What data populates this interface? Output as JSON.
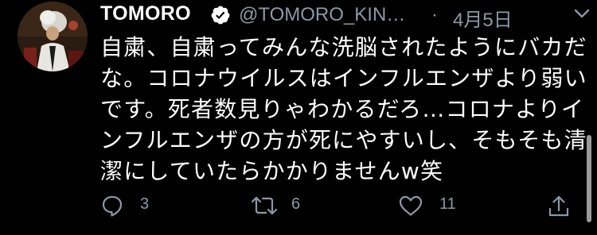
{
  "tweet": {
    "display_name": "TOMORO",
    "handle": "@TOMORO_KIN…",
    "separator": "·",
    "date": "4月5日",
    "text_lines": [
      "自粛、自粛ってみんな洗脳されたようにバカだ",
      "な。コロナウイルスはインフルエンザより弱い",
      "です。死者数見りゃわかるだろ…コロナよりイ",
      "ンフルエンザの方が死にやすいし、そもそも清",
      "潔にしていたらかかりませんw笑"
    ],
    "reply_count": "3",
    "retweet_count": "6",
    "like_count": "11"
  },
  "icons": {
    "verified": "verified-badge-icon",
    "caret": "chevron-down-icon",
    "reply": "reply-icon",
    "retweet": "retweet-icon",
    "like": "heart-icon",
    "share": "share-icon"
  },
  "colors": {
    "background": "#000000",
    "text": "#ffffff",
    "secondary": "#8b98a5"
  }
}
